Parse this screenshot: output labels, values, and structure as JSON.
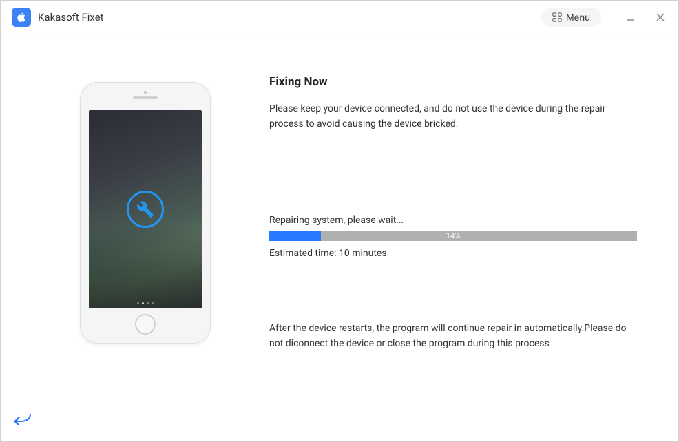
{
  "app": {
    "title": "Kakasoft Fixet",
    "menu_label": "Menu"
  },
  "main": {
    "heading": "Fixing Now",
    "description": "Please keep your device connected, and do not use the device during the repair process to avoid causing the device bricked.",
    "progress_label": "Repairing system, please wait...",
    "progress_percent": 14,
    "progress_percent_text": "14%",
    "estimated_time": "Estimated time: 10 minutes",
    "footer_note": "After the device restarts, the program will continue repair in automatically.Please do not diconnect the device or close the program during this process"
  },
  "colors": {
    "accent": "#2979ff",
    "icon_blue": "#2196f3"
  }
}
